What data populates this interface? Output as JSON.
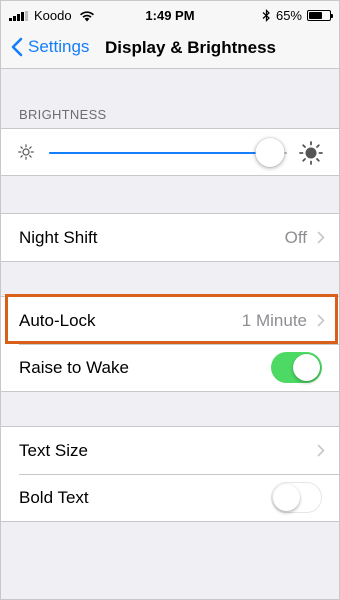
{
  "status_bar": {
    "carrier": "Koodo",
    "time": "1:49 PM",
    "battery_percent": "65%",
    "battery_level": 0.65,
    "icons": [
      "signal-icon",
      "wifi-icon",
      "bluetooth-icon",
      "battery-icon"
    ]
  },
  "nav": {
    "back_label": "Settings",
    "title": "Display & Brightness"
  },
  "brightness": {
    "section_header": "BRIGHTNESS",
    "level": 0.93,
    "icons": [
      "sun-small-icon",
      "sun-large-icon"
    ]
  },
  "night_shift": {
    "label": "Night Shift",
    "value": "Off"
  },
  "auto_lock": {
    "label": "Auto-Lock",
    "value": "1 Minute",
    "highlight_color": "#d9601a"
  },
  "raise_to_wake": {
    "label": "Raise to Wake",
    "on": true
  },
  "text_size": {
    "label": "Text Size"
  },
  "bold_text": {
    "label": "Bold Text",
    "on": false
  },
  "colors": {
    "accent": "#147efb",
    "toggle_on": "#4cd964",
    "background": "#efeff4"
  }
}
